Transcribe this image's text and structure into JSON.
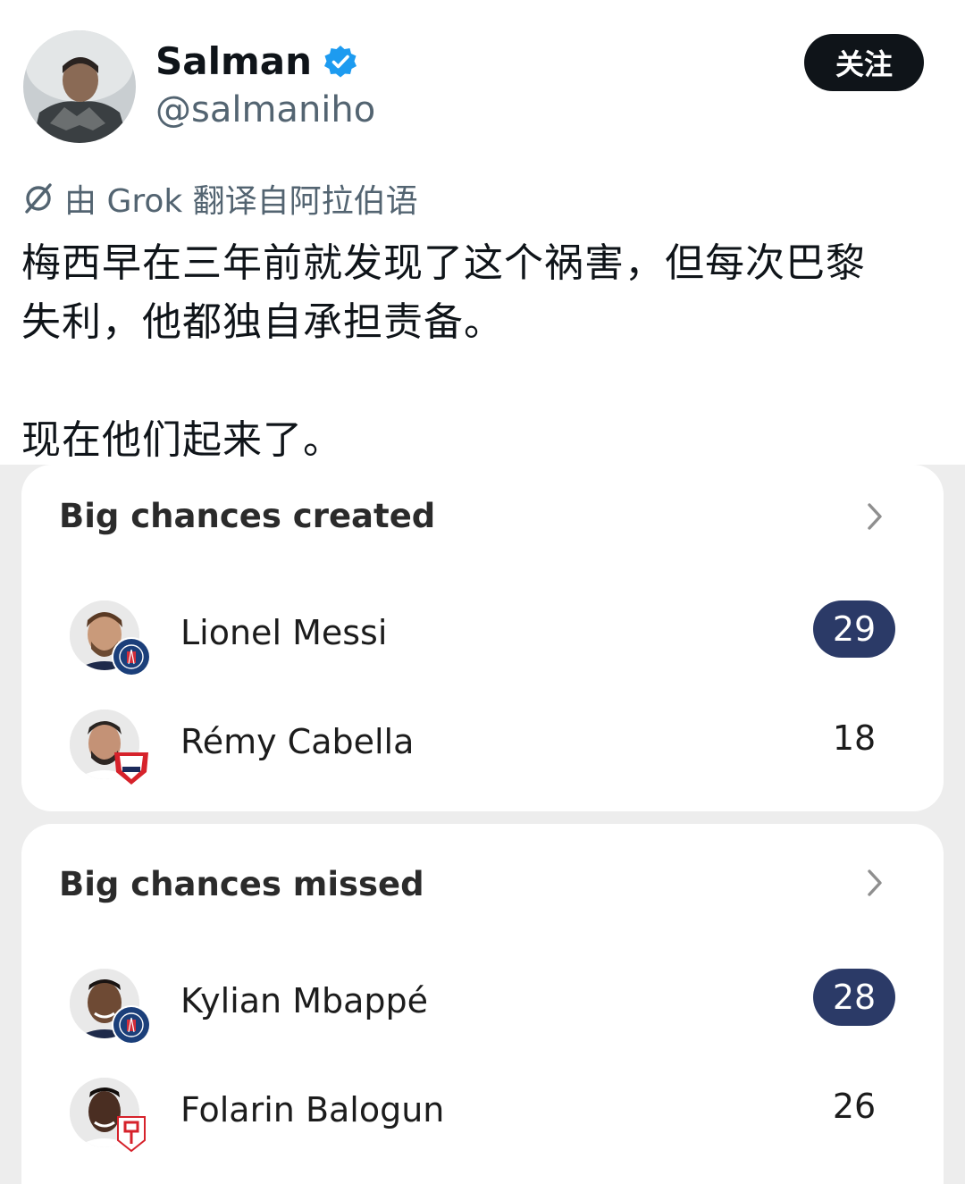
{
  "header": {
    "display_name": "Salman",
    "handle": "@salmaniho",
    "follow_label": "关注"
  },
  "translation": {
    "notice": "由 Grok 翻译自阿拉伯语"
  },
  "tweet": {
    "lines": [
      "梅西早在三年前就发现了这个祸害，但每次巴黎",
      "失利，他都独自承担责备。",
      "现在他们起来了。"
    ]
  },
  "cards": [
    {
      "title": "Big chances created",
      "players": [
        {
          "name": "Lionel Messi",
          "value": "29",
          "highlight": true,
          "club": "PSG"
        },
        {
          "name": "Rémy Cabella",
          "value": "18",
          "highlight": false,
          "club": "LOSC"
        }
      ]
    },
    {
      "title": "Big chances missed",
      "players": [
        {
          "name": "Kylian Mbappé",
          "value": "28",
          "highlight": true,
          "club": "PSG"
        },
        {
          "name": "Folarin Balogun",
          "value": "26",
          "highlight": false,
          "club": "Stade Reims"
        }
      ]
    }
  ],
  "colors": {
    "verified_blue": "#1d9bf0",
    "pill_navy": "#2b3a67",
    "follow_black": "#0f1419",
    "secondary_text": "#536471"
  },
  "icons": {
    "verified": "verified-badge-icon",
    "grok": "grok-icon",
    "chevron": "chevron-right-icon"
  }
}
